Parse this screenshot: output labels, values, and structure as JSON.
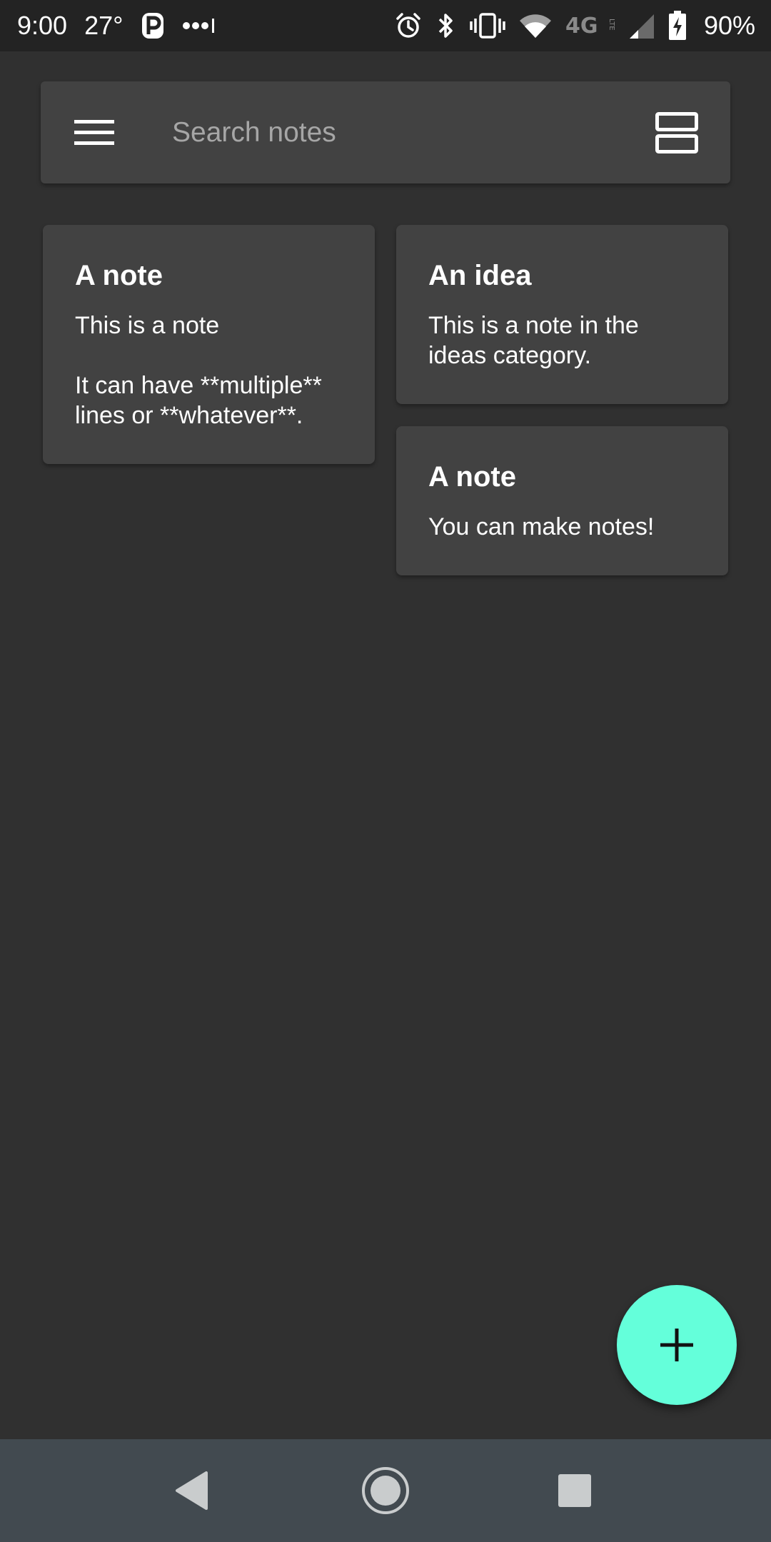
{
  "status_bar": {
    "time": "9:00",
    "temperature": "27°",
    "battery_percent": "90%",
    "icons": [
      "parking-app-icon",
      "more-notifications-icon",
      "alarm-icon",
      "bluetooth-icon",
      "vibrate-icon",
      "wifi-icon",
      "4g-lte-icon",
      "cell-signal-icon",
      "battery-charging-icon"
    ]
  },
  "search": {
    "placeholder": "Search notes",
    "value": ""
  },
  "notes": [
    {
      "title": "A note",
      "body": "This is a note\n\nIt can have **multiple** lines or **whatever**."
    },
    {
      "title": "An idea",
      "body": "This is a note in the ideas category."
    },
    {
      "title": "A note",
      "body": "You can make notes!"
    }
  ],
  "fab": {
    "icon": "plus-icon",
    "color": "#64ffda"
  },
  "navigation": {
    "icons": [
      "back-icon",
      "home-icon",
      "recents-icon"
    ]
  },
  "colors": {
    "background": "#303030",
    "card": "#424242",
    "status_bar": "#232323",
    "nav_bar": "#424a50",
    "accent": "#64ffda"
  }
}
